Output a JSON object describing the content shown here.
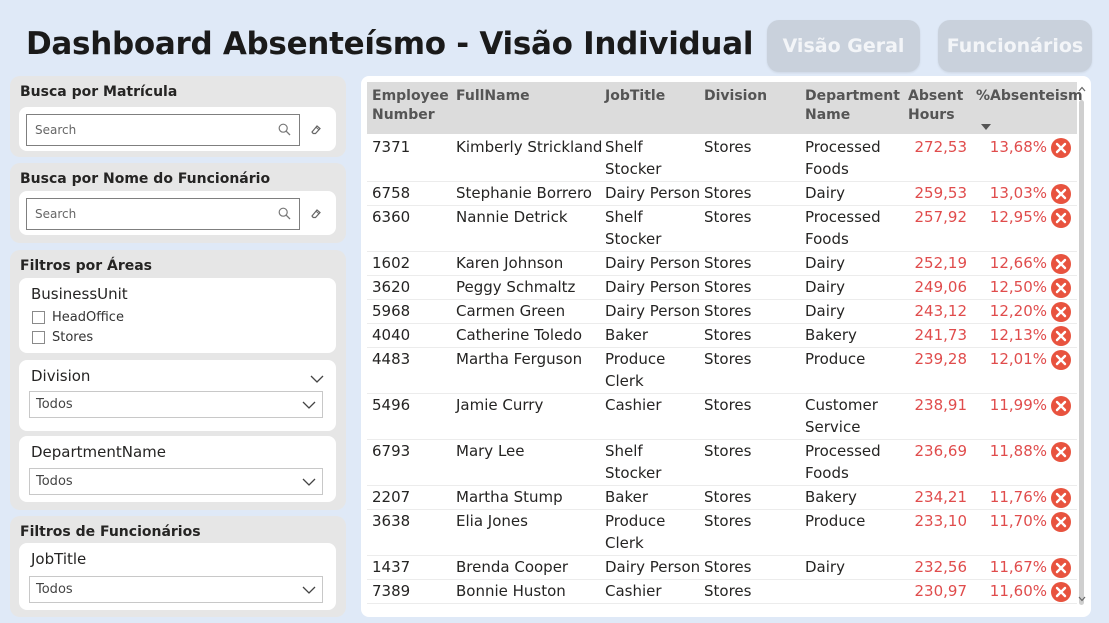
{
  "header": {
    "title": "Dashboard Absenteísmo - Visão Individual",
    "nav": [
      "Visão Geral",
      "Funcionários"
    ]
  },
  "filters": {
    "matricula": {
      "label": "Busca por Matrícula",
      "placeholder": "Search"
    },
    "nome": {
      "label": "Busca por Nome do Funcionário",
      "placeholder": "Search"
    },
    "areas": {
      "label": "Filtros por Áreas",
      "business_unit": {
        "title": "BusinessUnit",
        "options": [
          "HeadOffice",
          "Stores"
        ]
      },
      "division": {
        "title": "Division",
        "value": "Todos"
      },
      "department": {
        "title": "DepartmentName",
        "value": "Todos"
      }
    },
    "funcionarios": {
      "label": "Filtros de Funcionários",
      "job_title": {
        "title": "JobTitle",
        "value": "Todos"
      }
    }
  },
  "table": {
    "columns": [
      [
        "Employee",
        "Number"
      ],
      [
        "FullName"
      ],
      [
        "JobTitle"
      ],
      [
        "Division"
      ],
      [
        "Department",
        "Name"
      ],
      [
        "Absent",
        "Hours"
      ],
      [
        "%Absenteism"
      ]
    ],
    "rows": [
      {
        "id": "7371",
        "name": "Kimberly Strickland",
        "job": [
          "Shelf",
          "Stocker"
        ],
        "division": "Stores",
        "dept": [
          "Processed",
          "Foods"
        ],
        "hours": "272,53",
        "pct": "13,68%"
      },
      {
        "id": "6758",
        "name": "Stephanie Borrero",
        "job": [
          "Dairy Person"
        ],
        "division": "Stores",
        "dept": [
          "Dairy"
        ],
        "hours": "259,53",
        "pct": "13,03%"
      },
      {
        "id": "6360",
        "name": "Nannie Detrick",
        "job": [
          "Shelf",
          "Stocker"
        ],
        "division": "Stores",
        "dept": [
          "Processed",
          "Foods"
        ],
        "hours": "257,92",
        "pct": "12,95%"
      },
      {
        "id": "1602",
        "name": "Karen Johnson",
        "job": [
          "Dairy Person"
        ],
        "division": "Stores",
        "dept": [
          "Dairy"
        ],
        "hours": "252,19",
        "pct": "12,66%"
      },
      {
        "id": "3620",
        "name": "Peggy Schmaltz",
        "job": [
          "Dairy Person"
        ],
        "division": "Stores",
        "dept": [
          "Dairy"
        ],
        "hours": "249,06",
        "pct": "12,50%"
      },
      {
        "id": "5968",
        "name": "Carmen Green",
        "job": [
          "Dairy Person"
        ],
        "division": "Stores",
        "dept": [
          "Dairy"
        ],
        "hours": "243,12",
        "pct": "12,20%"
      },
      {
        "id": "4040",
        "name": "Catherine Toledo",
        "job": [
          "Baker"
        ],
        "division": "Stores",
        "dept": [
          "Bakery"
        ],
        "hours": "241,73",
        "pct": "12,13%"
      },
      {
        "id": "4483",
        "name": "Martha Ferguson",
        "job": [
          "Produce",
          "Clerk"
        ],
        "division": "Stores",
        "dept": [
          "Produce"
        ],
        "hours": "239,28",
        "pct": "12,01%"
      },
      {
        "id": "5496",
        "name": "Jamie Curry",
        "job": [
          "Cashier"
        ],
        "division": "Stores",
        "dept": [
          "Customer",
          "Service"
        ],
        "hours": "238,91",
        "pct": "11,99%"
      },
      {
        "id": "6793",
        "name": "Mary Lee",
        "job": [
          "Shelf",
          "Stocker"
        ],
        "division": "Stores",
        "dept": [
          "Processed",
          "Foods"
        ],
        "hours": "236,69",
        "pct": "11,88%"
      },
      {
        "id": "2207",
        "name": "Martha Stump",
        "job": [
          "Baker"
        ],
        "division": "Stores",
        "dept": [
          "Bakery"
        ],
        "hours": "234,21",
        "pct": "11,76%"
      },
      {
        "id": "3638",
        "name": "Elia Jones",
        "job": [
          "Produce",
          "Clerk"
        ],
        "division": "Stores",
        "dept": [
          "Produce"
        ],
        "hours": "233,10",
        "pct": "11,70%"
      },
      {
        "id": "1437",
        "name": "Brenda Cooper",
        "job": [
          "Dairy Person"
        ],
        "division": "Stores",
        "dept": [
          "Dairy"
        ],
        "hours": "232,56",
        "pct": "11,67%"
      },
      {
        "id": "7389",
        "name": "Bonnie Huston",
        "job": [
          "Cashier"
        ],
        "division": "Stores",
        "dept": [
          ""
        ],
        "hours": "230,97",
        "pct": "11,60%"
      }
    ]
  },
  "colors": {
    "background": "#dfe9f7",
    "alert": "#e04c4c",
    "nav_button": "#c9d1dc"
  }
}
